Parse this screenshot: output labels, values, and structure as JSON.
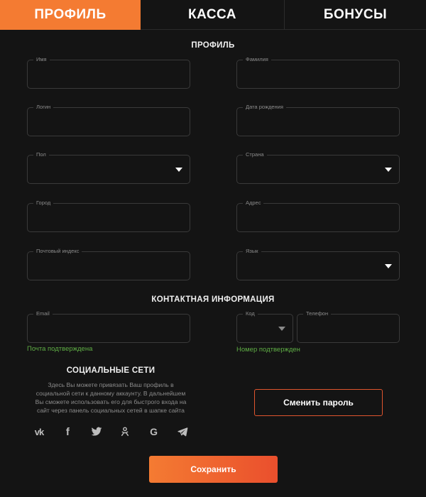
{
  "tabs": [
    {
      "label": "ПРОФИЛЬ",
      "active": true
    },
    {
      "label": "КАССА",
      "active": false
    },
    {
      "label": "БОНУСЫ",
      "active": false
    }
  ],
  "profile": {
    "title": "ПРОФИЛЬ",
    "fields": {
      "first_name": {
        "label": "Имя",
        "value": ""
      },
      "last_name": {
        "label": "Фамилия",
        "value": ""
      },
      "login": {
        "label": "Логин",
        "value": ""
      },
      "birth_date": {
        "label": "Дата рождения",
        "value": ""
      },
      "gender": {
        "label": "Пол",
        "value": ""
      },
      "country": {
        "label": "Страна",
        "value": ""
      },
      "city": {
        "label": "Город",
        "value": ""
      },
      "address": {
        "label": "Адрес",
        "value": ""
      },
      "postal_code": {
        "label": "Почтовый индекс",
        "value": ""
      },
      "language": {
        "label": "Язык",
        "value": ""
      }
    }
  },
  "contact": {
    "title": "КОНТАКТНАЯ ИНФОРМАЦИЯ",
    "email": {
      "label": "Email",
      "value": "",
      "status": "Почта подтверждена"
    },
    "code": {
      "label": "Код",
      "value": ""
    },
    "phone": {
      "label": "Телефон",
      "value": "",
      "status": "Номер подтвержден"
    }
  },
  "social": {
    "title": "СОЦИАЛЬНЫЕ СЕТИ",
    "description": "Здесь Вы можете привязать Ваш профиль в социальной сети к данному аккаунту. В дальнейшем Вы сможете использовать его для быстрого входа на сайт через панель социальных сетей в шапке сайта",
    "icons": [
      "vk-icon",
      "facebook-icon",
      "twitter-icon",
      "odnoklassniki-icon",
      "google-icon",
      "telegram-icon"
    ]
  },
  "buttons": {
    "change_password": "Сменить пароль",
    "save": "Сохранить"
  },
  "colors": {
    "accent": "#f47b32",
    "accent_end": "#ea4f2d",
    "background": "#141414",
    "success": "#5fae45"
  }
}
